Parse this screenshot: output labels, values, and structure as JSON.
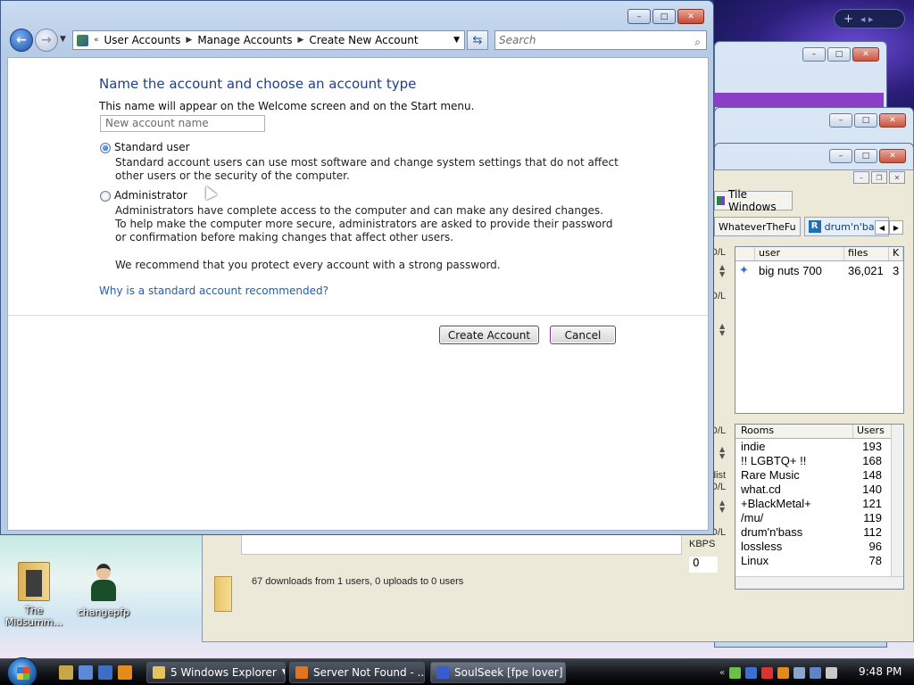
{
  "main_window": {
    "address_parts": [
      "User Accounts",
      "Manage Accounts",
      "Create New Account"
    ],
    "search_placeholder": "Search",
    "heading": "Name the account and choose an account type",
    "subtext": "This name will appear on the Welcome screen and on the Start menu.",
    "name_placeholder": "New account name",
    "options": [
      {
        "label": "Standard user",
        "selected": true,
        "description": "Standard account users can use most software and change system settings that do not affect other users or the security of the computer."
      },
      {
        "label": "Administrator",
        "selected": false,
        "description": "Administrators have complete access to the computer and can make any desired changes. To help make the computer more secure, administrators are asked to provide their password or confirmation before making changes that affect other users."
      }
    ],
    "recommend_text": "We recommend that you protect every account with a strong password.",
    "link_text": "Why is a standard account recommended?",
    "create_button": "Create Account",
    "cancel_button": "Cancel"
  },
  "soulseek": {
    "tile_button": "Tile Windows",
    "tabs": [
      "WhateverTheFu",
      "drum'n'bass"
    ],
    "users_columns": [
      "user",
      "files",
      "K"
    ],
    "users_rows": [
      {
        "user": "big nuts 700",
        "files": "36,021",
        "k": "3"
      }
    ],
    "rooms_columns": [
      "Rooms",
      "Users"
    ],
    "rooms": [
      {
        "name": "indie",
        "users": "193"
      },
      {
        "name": "!! LGBTQ+ !!",
        "users": "168"
      },
      {
        "name": "Rare Music",
        "users": "148"
      },
      {
        "name": "what.cd",
        "users": "140"
      },
      {
        "name": "+BlackMetal+",
        "users": "121"
      },
      {
        "name": "/mu/",
        "users": "119"
      },
      {
        "name": "drum'n'bass",
        "users": "112"
      },
      {
        "name": "lossless",
        "users": "96"
      },
      {
        "name": "Linux",
        "users": "78"
      }
    ],
    "side_labels": [
      "D/L",
      "D/L",
      "D/L",
      "dist",
      "D/L",
      "D/L"
    ],
    "kbps_label": "KBPS",
    "kbps_value": "0",
    "status": "67 downloads from 1 users, 0 uploads to 0 users"
  },
  "desktop_icons": [
    {
      "label": "The Midsumm...",
      "icon": "folder-icon"
    },
    {
      "label": "changepfp",
      "icon": "user-icon"
    }
  ],
  "taskbar": {
    "tasks": [
      {
        "label": "5 Windows Explorer",
        "icon": "folder-icon"
      },
      {
        "label": "Server Not Found - ...",
        "icon": "firefox-icon"
      },
      {
        "label": "SoulSeek [fpe lover] ...",
        "icon": "soulseek-icon"
      }
    ],
    "clock": "9:48 PM"
  },
  "colors": {
    "heading": "#1e3f8c",
    "link": "#1f5fb0",
    "button_border": "#70378f"
  }
}
